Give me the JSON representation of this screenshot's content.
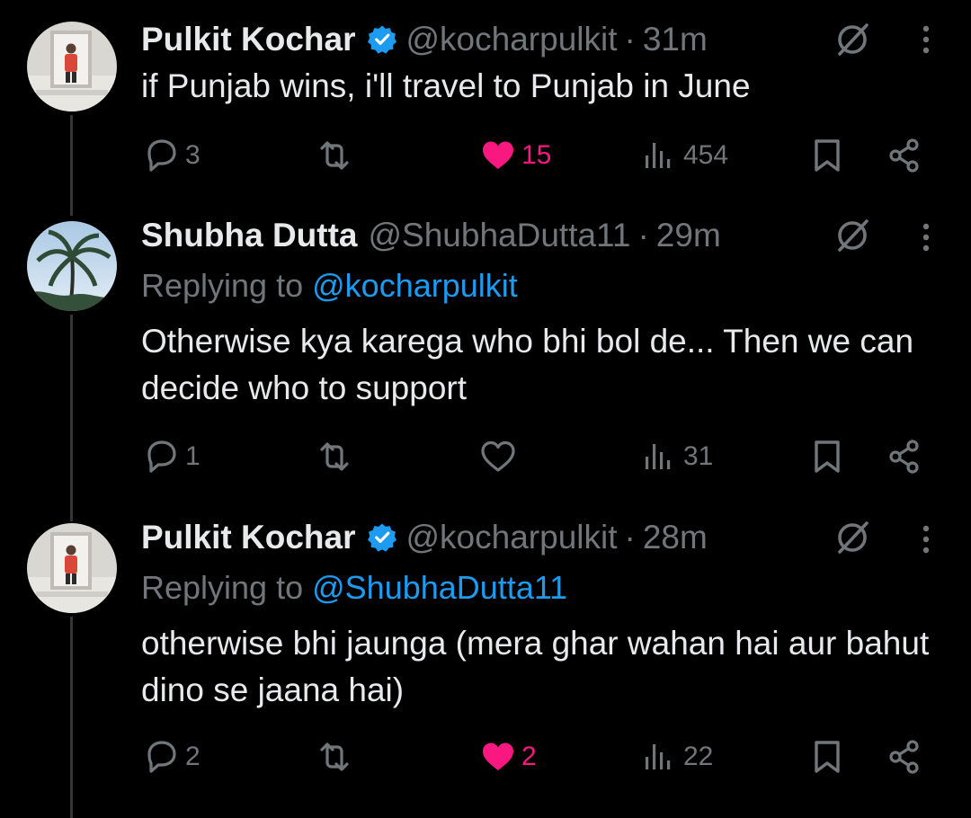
{
  "colors": {
    "background": "#000000",
    "text": "#e7e9ea",
    "muted": "#71767b",
    "link": "#1d9bf0",
    "like": "#f91880",
    "verified": "#1d9bf0"
  },
  "tweets": [
    {
      "name": "Pulkit Kochar",
      "verified": true,
      "handle": "@kocharpulkit",
      "dot": "·",
      "time": "31m",
      "replying_label": "",
      "replying_to": "",
      "text": "if Punjab wins, i'll travel to Punjab in June",
      "replies": "3",
      "retweets": "",
      "likes": "15",
      "liked": true,
      "views": "454",
      "avatar": "profile-photo-man-red-shirt",
      "icons": [
        "reply-icon",
        "retweet-icon",
        "like-icon",
        "views-icon",
        "bookmark-icon",
        "share-icon",
        "mute-icon",
        "more-icon"
      ]
    },
    {
      "name": "Shubha Dutta",
      "verified": false,
      "handle": "@ShubhaDutta11",
      "dot": "·",
      "time": "29m",
      "replying_label": "Replying to",
      "replying_to": "@kocharpulkit",
      "text": "Otherwise kya karega who bhi bol de... Then we can decide who to support",
      "replies": "1",
      "retweets": "",
      "likes": "",
      "liked": false,
      "views": "31",
      "avatar": "palm-tree-photo",
      "icons": [
        "reply-icon",
        "retweet-icon",
        "like-icon",
        "views-icon",
        "bookmark-icon",
        "share-icon",
        "mute-icon",
        "more-icon"
      ]
    },
    {
      "name": "Pulkit Kochar",
      "verified": true,
      "handle": "@kocharpulkit",
      "dot": "·",
      "time": "28m",
      "replying_label": "Replying to",
      "replying_to": "@ShubhaDutta11",
      "text": "otherwise bhi jaunga (mera ghar wahan hai aur bahut dino se jaana hai)",
      "replies": "2",
      "retweets": "",
      "likes": "2",
      "liked": true,
      "views": "22",
      "avatar": "profile-photo-man-red-shirt",
      "icons": [
        "reply-icon",
        "retweet-icon",
        "like-icon",
        "views-icon",
        "bookmark-icon",
        "share-icon",
        "mute-icon",
        "more-icon"
      ]
    }
  ]
}
